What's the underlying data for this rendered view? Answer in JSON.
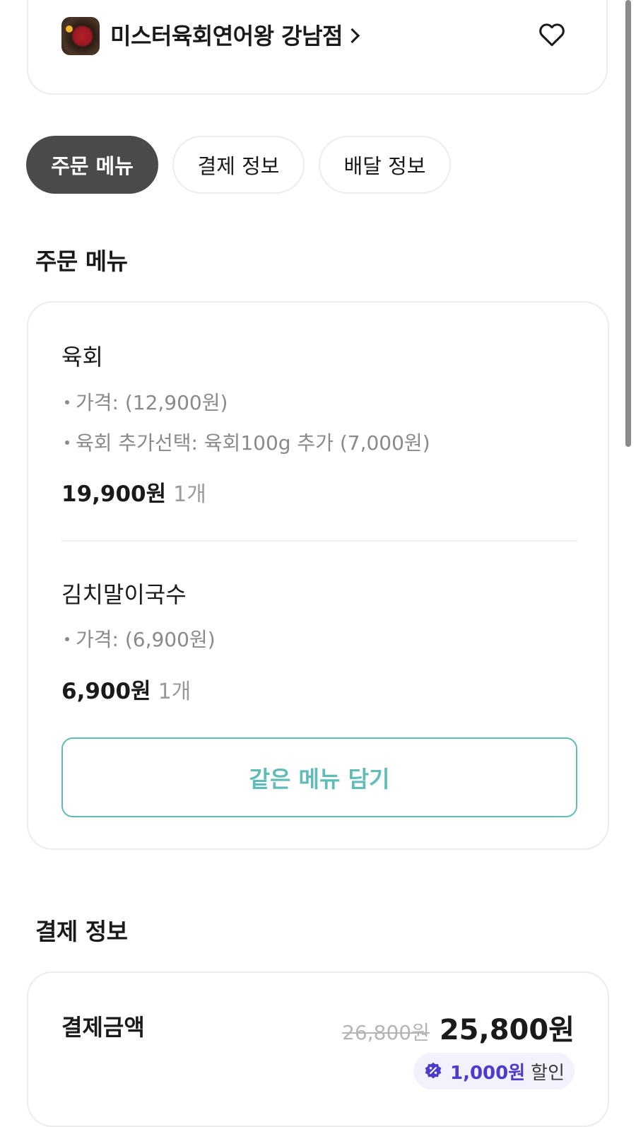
{
  "store": {
    "name": "미스터육회연어왕 강남점"
  },
  "tabs": [
    {
      "label": "주문 메뉴",
      "active": true
    },
    {
      "label": "결제 정보",
      "active": false
    },
    {
      "label": "배달 정보",
      "active": false
    }
  ],
  "order_section": {
    "title": "주문 메뉴",
    "items": [
      {
        "name": "육회",
        "options": [
          "가격: (12,900원)",
          "육회 추가선택: 육회100g 추가 (7,000원)"
        ],
        "price": "19,900원",
        "quantity": "1개"
      },
      {
        "name": "김치말이국수",
        "options": [
          "가격: (6,900원)"
        ],
        "price": "6,900원",
        "quantity": "1개"
      }
    ],
    "same_menu_button": "같은 메뉴 담기"
  },
  "payment_section": {
    "title": "결제 정보",
    "label": "결제금액",
    "original_amount": "26,800원",
    "final_amount": "25,800원",
    "discount": {
      "amount": "1,000원",
      "text": "할인"
    }
  },
  "colors": {
    "accent_teal": "#5fbcb7",
    "discount_purple": "#4b3ccf",
    "active_tab": "#4a4a4a"
  },
  "icons": {
    "store_thumbnail": "store-thumbnail-image",
    "store_link": "chevron-right-icon",
    "favorite": "heart-icon",
    "discount": "discount-badge-icon"
  }
}
